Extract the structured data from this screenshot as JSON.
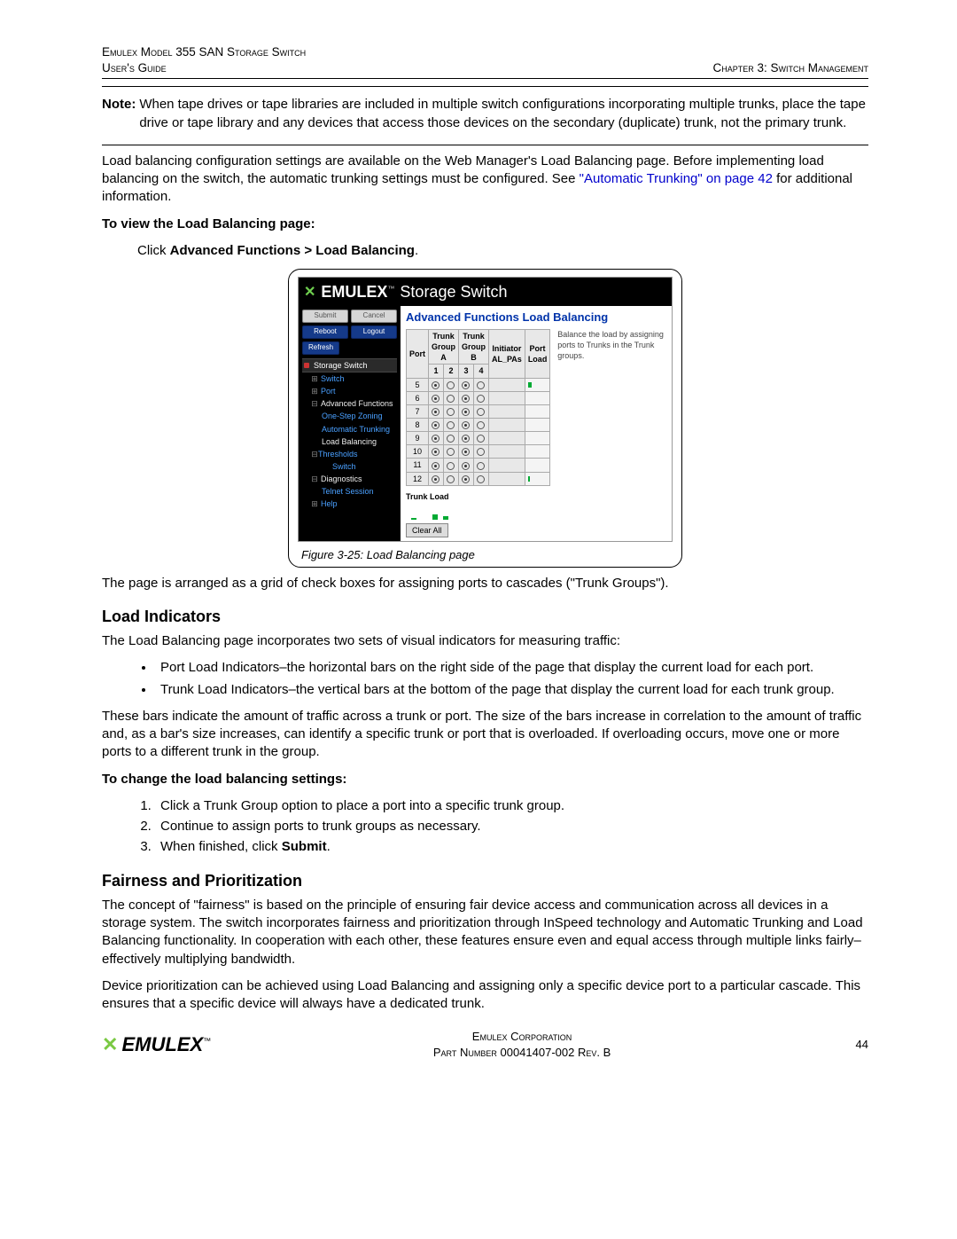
{
  "header": {
    "left_line1": "Emulex Model 355 SAN Storage Switch",
    "left_line2": "User's Guide",
    "right": "Chapter 3: Switch Management"
  },
  "note": {
    "label": "Note:",
    "text": "When tape drives or tape libraries are included in multiple switch configurations incorporating multiple trunks, place the tape drive or tape library and any devices that access those devices on the secondary (duplicate) trunk, not the primary trunk."
  },
  "intro_p1a": "Load balancing configuration settings are available on the Web Manager's Load Balancing page. Before implementing load balancing on the switch, the automatic trunking settings must be configured. See ",
  "intro_link": "\"Automatic Trunking\" on page 42",
  "intro_p1b": " for additional information.",
  "view_head": "To view the Load Balancing page:",
  "view_step_prefix": "Click ",
  "view_step_bold": "Advanced Functions > Load Balancing",
  "view_step_suffix": ".",
  "figure": {
    "app_brand": "EMULEX",
    "app_title_suffix": "Storage Switch",
    "nav": {
      "btn_submit": "Submit",
      "btn_cancel": "Cancel",
      "btn_reboot": "Reboot",
      "btn_logout": "Logout",
      "btn_refresh": "Refresh",
      "root": "Storage Switch",
      "switch": "Switch",
      "port": "Port",
      "adv": "Advanced Functions",
      "ozs": "One-Step Zoning",
      "at": "Automatic Trunking",
      "lb": "Load Balancing",
      "thr": "Thresholds",
      "thr_sub": "Switch",
      "diag": "Diagnostics",
      "telnet": "Telnet Session",
      "help": "Help"
    },
    "content": {
      "title": "Advanced Functions Load Balancing",
      "hint": "Balance the load by assigning ports to Trunks in the Trunk groups.",
      "th_trunk_a": "Trunk Group A",
      "th_trunk_b": "Trunk Group B",
      "th_port": "Port",
      "th_1": "1",
      "th_2": "2",
      "th_3": "3",
      "th_4": "4",
      "th_init": "Initiator AL_PAs",
      "th_pl": "Port Load",
      "ports": [
        "5",
        "6",
        "7",
        "8",
        "9",
        "10",
        "11",
        "12"
      ],
      "trunk_load_lbl": "Trunk Load",
      "clear_btn": "Clear All"
    },
    "caption": "Figure 3-25: Load Balancing page"
  },
  "after_fig_p": "The page is arranged as a grid of check boxes for assigning ports to cascades (\"Trunk Groups\").",
  "load_ind": {
    "title": "Load Indicators",
    "intro": "The Load Balancing page incorporates two sets of visual indicators for measuring traffic:",
    "b1": "Port Load Indicators–the horizontal bars on the right side of the page that display the current load for each port.",
    "b2": "Trunk Load Indicators–the vertical bars at the bottom of the page that display the current load for each trunk group.",
    "after": "These bars indicate the amount of traffic across a trunk or port. The size of the bars increase in correlation to the amount of traffic and, as a bar's size increases, can identify a specific trunk or port that is overloaded. If overloading occurs, move one or more ports to a different trunk in the group."
  },
  "change": {
    "title": "To change the load balancing settings:",
    "s1": "Click a Trunk Group option to place a port into a specific trunk group.",
    "s2": "Continue to assign ports to trunk groups as necessary.",
    "s3_a": "When finished, click ",
    "s3_b": "Submit",
    "s3_c": "."
  },
  "fair": {
    "title": "Fairness and Prioritization",
    "p1": "The concept of \"fairness\" is based on the principle of ensuring fair device access and communication across all devices in a storage system. The switch incorporates fairness and prioritization through InSpeed technology and Automatic Trunking and Load Balancing functionality. In cooperation with each other, these features ensure even and equal access through multiple links fairly–effectively multiplying bandwidth.",
    "p2": "Device prioritization can be achieved using Load Balancing and assigning only a specific device port to a particular cascade. This ensures that a specific device will always have a dedicated trunk."
  },
  "footer": {
    "logo": "EMULEX",
    "line1": "Emulex Corporation",
    "line2": "Part Number 00041407-002 Rev. B",
    "page": "44"
  }
}
